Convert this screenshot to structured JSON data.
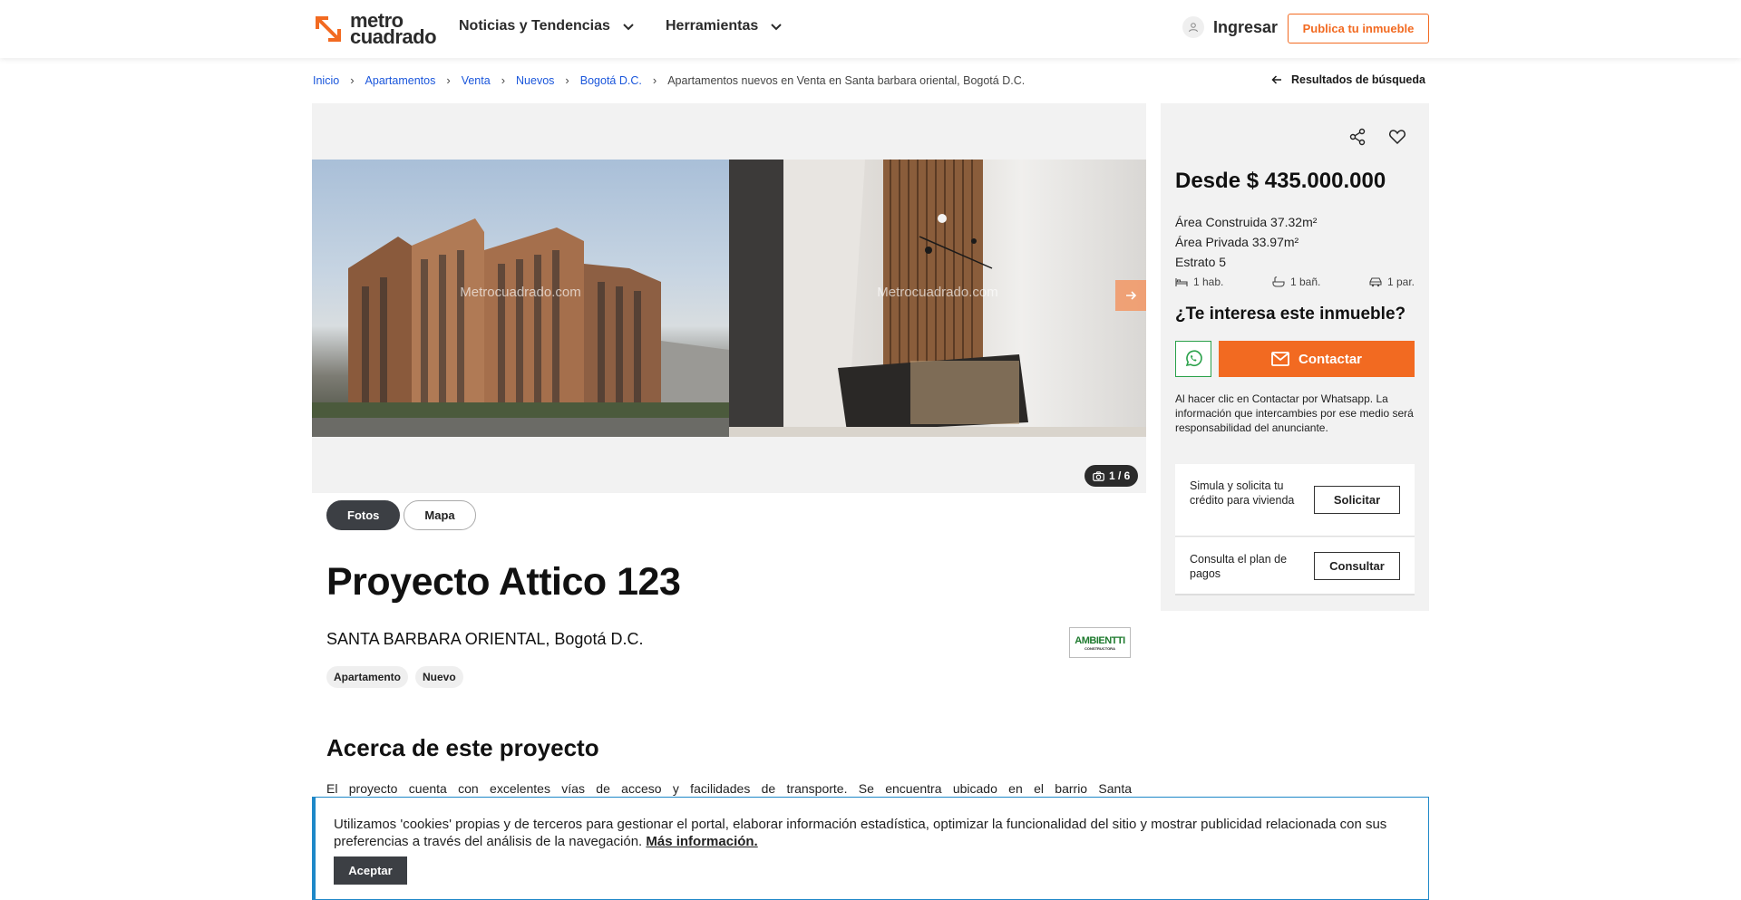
{
  "header": {
    "logo_line1": "metro",
    "logo_line2": "cuadrado",
    "nav": [
      "Noticias y Tendencias",
      "Herramientas"
    ],
    "login_label": "Ingresar",
    "publish_label": "Publica tu inmueble"
  },
  "breadcrumb": {
    "items": [
      "Inicio",
      "Apartamentos",
      "Venta",
      "Nuevos",
      "Bogotá D.C."
    ],
    "separator": "›",
    "current": "Apartamentos nuevos en Venta en Santa barbara oriental, Bogotá D.C.",
    "back_label": "Resultados de búsqueda"
  },
  "gallery": {
    "watermark": "Metrocuadrado.com",
    "counter": "1 / 6",
    "tabs": [
      "Fotos",
      "Mapa"
    ]
  },
  "project": {
    "title": "Proyecto Attico 123",
    "location": "SANTA BARBARA ORIENTAL, Bogotá D.C.",
    "builder_logo_main": "AMBIENTTI",
    "builder_logo_sub": "CONSTRUCTORA",
    "chips": [
      "Apartamento",
      "Nuevo"
    ],
    "about_title": "Acerca de este proyecto",
    "about_text": "El proyecto cuenta con excelentes vías de acceso y facilidades de transporte. Se encuentra ubicado en el barrio Santa"
  },
  "sidebar": {
    "price": "Desde $ 435.000.000",
    "specs": [
      "Área Construida 37.32m²",
      "Área Privada 33.97m²",
      "Estrato 5"
    ],
    "features": [
      {
        "icon": "bed-icon",
        "label": "1 hab."
      },
      {
        "icon": "bathtub-icon",
        "label": "1 bañ."
      },
      {
        "icon": "car-icon",
        "label": "1 par."
      }
    ],
    "interest_title": "¿Te interesa este inmueble?",
    "contact_label": "Contactar",
    "disclaimer": "Al hacer clic en Contactar por Whatsapp. La información que intercambies por ese medio será responsabilidad del anunciante.",
    "credit_text": "Simula y solicita tu crédito para vivienda",
    "credit_button": "Solicitar",
    "plan_text": "Consulta el plan de pagos",
    "plan_button": "Consultar"
  },
  "cookie": {
    "text": "Utilizamos 'cookies' propias y de terceros para gestionar el portal, elaborar información estadística, optimizar la funcionalidad del sitio y mostrar publicidad relacionada con sus preferencias a través del análisis de la navegación.",
    "more_label": "Más información.",
    "accept_label": "Aceptar"
  },
  "colors": {
    "brand_orange": "#f26a21",
    "link_blue": "#1a56db",
    "whatsapp_green": "#2aa14a",
    "dark_button": "#3c3f44"
  }
}
